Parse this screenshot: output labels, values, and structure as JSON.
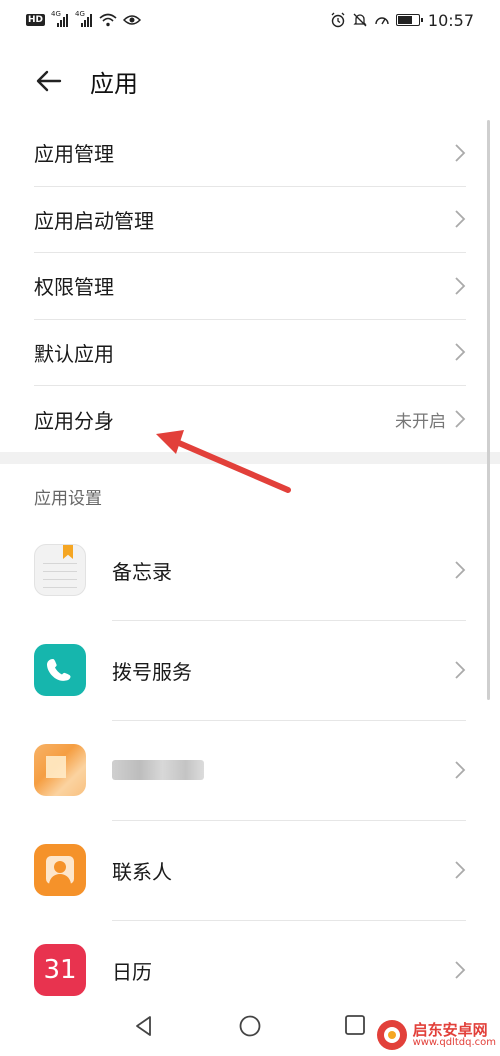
{
  "status_bar": {
    "hd": "HD",
    "net1": "4G",
    "net2": "4G",
    "time": "10:57",
    "battery_level": 0.75
  },
  "header": {
    "title": "应用",
    "back_icon": "arrow-left-icon"
  },
  "menu": [
    {
      "label": "应用管理",
      "value": ""
    },
    {
      "label": "应用启动管理",
      "value": ""
    },
    {
      "label": "权限管理",
      "value": ""
    },
    {
      "label": "默认应用",
      "value": ""
    },
    {
      "label": "应用分身",
      "value": "未开启"
    }
  ],
  "section": {
    "title": "应用设置"
  },
  "apps": [
    {
      "label": "备忘录",
      "icon": "memo-icon"
    },
    {
      "label": "拨号服务",
      "icon": "phone-icon"
    },
    {
      "label": "",
      "icon": "blurred-app-icon"
    },
    {
      "label": "联系人",
      "icon": "contacts-icon"
    },
    {
      "label": "日历",
      "icon": "calendar-icon",
      "icon_text": "31"
    }
  ],
  "annotation": {
    "arrow_color": "#e2403a"
  },
  "watermark": {
    "name": "启东安卓网",
    "url": "www.qdltdq.com"
  }
}
